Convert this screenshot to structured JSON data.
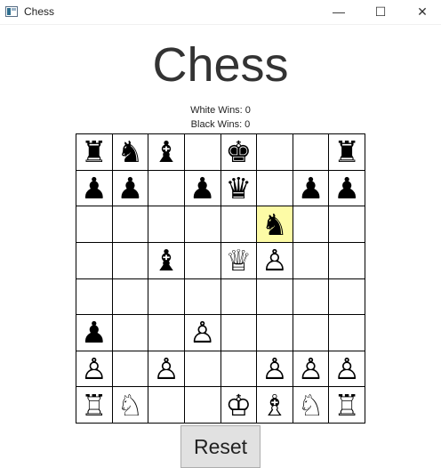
{
  "window": {
    "title": "Chess",
    "minimize_glyph": "—",
    "maximize_glyph": "☐",
    "close_glyph": "✕"
  },
  "heading": "Chess",
  "scores": {
    "white": "White Wins: 0",
    "black": "Black Wins: 0"
  },
  "board": {
    "highlight_cell": [
      2,
      5
    ],
    "highlight_color": "#fdfba6",
    "rows": [
      [
        "♜",
        "♞",
        "♝",
        "",
        "♚",
        "",
        "",
        "♜"
      ],
      [
        "♟",
        "♟",
        "",
        "♟",
        "♛",
        "",
        "♟",
        "♟"
      ],
      [
        "",
        "",
        "",
        "",
        "",
        "♞",
        "",
        ""
      ],
      [
        "",
        "",
        "♝",
        "",
        "♕",
        "♙",
        "",
        ""
      ],
      [
        "",
        "",
        "",
        "",
        "",
        "",
        "",
        ""
      ],
      [
        "♟",
        "",
        "",
        "♙",
        "",
        "",
        "",
        ""
      ],
      [
        "♙",
        "",
        "♙",
        "",
        "",
        "♙",
        "♙",
        "♙"
      ],
      [
        "♖",
        "♘",
        "",
        "",
        "♔",
        "♗",
        "♘",
        "♖"
      ]
    ],
    "piece_names": [
      [
        "black-rook",
        "black-knight",
        "black-bishop",
        "",
        "black-king",
        "",
        "",
        "black-rook"
      ],
      [
        "black-pawn",
        "black-pawn",
        "",
        "black-pawn",
        "black-queen",
        "",
        "black-pawn",
        "black-pawn"
      ],
      [
        "",
        "",
        "",
        "",
        "",
        "black-knight",
        "",
        ""
      ],
      [
        "",
        "",
        "black-bishop",
        "",
        "white-queen",
        "white-pawn",
        "",
        ""
      ],
      [
        "",
        "",
        "",
        "",
        "",
        "",
        "",
        ""
      ],
      [
        "black-pawn",
        "",
        "",
        "white-pawn",
        "",
        "",
        "",
        ""
      ],
      [
        "white-pawn",
        "",
        "white-pawn",
        "",
        "",
        "white-pawn",
        "white-pawn",
        "white-pawn"
      ],
      [
        "white-rook",
        "white-knight",
        "",
        "",
        "white-king",
        "white-bishop",
        "white-knight",
        "white-rook"
      ]
    ]
  },
  "reset_label": "Reset"
}
